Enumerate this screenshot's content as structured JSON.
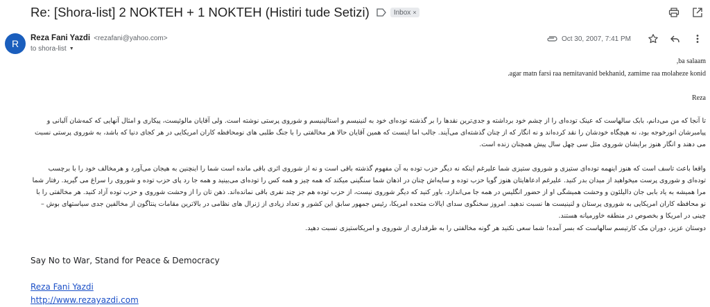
{
  "email": {
    "subject": "Re: [Shora-list] 2 NOKTEH + 1 NOKTEH (Histiri tude Setizi)",
    "label": "Inbox",
    "sender_name": "Reza Fani Yazdi",
    "sender_email": "<rezafani@yahoo.com>",
    "recipient": "to shora-list",
    "date": "Oct 30, 2007, 7:41 PM"
  },
  "icons": {
    "label": "label-icon",
    "print": "print-icon",
    "open_new": "open-in-new-icon",
    "attachment": "attachment-icon",
    "star": "star-icon",
    "reply": "reply-icon",
    "more": "more-vert-icon",
    "expand": "chevron-down-icon"
  },
  "avatar": {
    "letter": "R",
    "color": "#1a5ebd"
  },
  "body": {
    "greeting": ",ba salaam",
    "note": ".agar matn farsi raa nemitavanid bekhanid, zamime raa molaheze konid",
    "signoff": "Reza",
    "para1": "تا آنجا که من می‌دانم، بابک سالهاست که عینک توده‌ای را از چشم خود برداشته و جدی‌ترین نقدها را بر گذشته توده‌ای خود به لنینیسم و استالینیسم و شوروی پرستی نوشته است. ولی آقایان مالوئیست، پیکاری و امثال آنهایی که کمه‌شان آلبانی و پیامبرشان انورخوجه بود، نه هیچگاه خودشان را نقد کرده‌اند و نه انگار که از چنان گذشته‌ای می‌آیند. جالب اما اینست که همین آقایان حالا هر مخالفتی را با جنگ طلبی های نومحافظه کاران امریکایی در هر کجای دنیا که باشد، به شوروی پرستی نسبت می دهند و انگار هنوز برایشان شوروی مثل سی چهل سال پیش همچنان زنده است.",
    "para2": "واقعا باعث تاسف است که هنوز اینهمه توده‌ای ستیزی و شوروی ستیزی شما علیرغم اینکه نه دیگر حزب توده به آن مفهوم گذشته باقی است و نه از شوروی اثری باقی مانده است شما را اینچنین به هیجان می‌آورد و هرمخالف خود را با برچسب توده‌ای و شوروی پرست میخواهید از میدان بدر کنید. علیرغم ادعاهایتان هنوز گویا حزب توده و سایه‌اش چنان در اذهان شما سنگینی میکند که همه چیز و همه کس را توده‌ای می‌بینید و همه جا رد پای حزب توده و شوروی را سراغ می گیرید. رفتار شما مرا همیشه به یاد بابی جان دالیلئون و وحشت همیشگی او از حضور انگلیس در همه جا می‌اندازد. باور کنید که دیگر شوروی نیست، از حزب توده هم جز چند نفری باقی نمانده‌اند. ذهن تان را از وحشت شوروی و حزب توده آزاد کنید. هر مخالفتی را با نو محافظه کاران امریکایی به شوروی پرستان و لنینیست ها نسبت ندهید. امروز سخنگوی سدای ایالات متحده امریکا، رئیس جمهور سابق این کشور و تعداد زیادی از ژنرال های نظامی در بالاترین مقامات پنتاگون از مخالفین جدی سیاستهای بوش – چینی در امریکا و بخصوص در منطقه خاورمیانه هستند.",
    "para3": "دوستان عزیز، دوران مک کارتیسم سالهاست که بسر آمده! شما سعی نکنید هر گونه مخالفتی را به طرفداری از شوروی و امریکاستیزی نسبت دهید.",
    "slogan": "Say No to War, Stand for Peace & Democracy",
    "sig_name": "Reza Fani Yazdi",
    "sig_url": "http://www.rezayazdi.com"
  }
}
